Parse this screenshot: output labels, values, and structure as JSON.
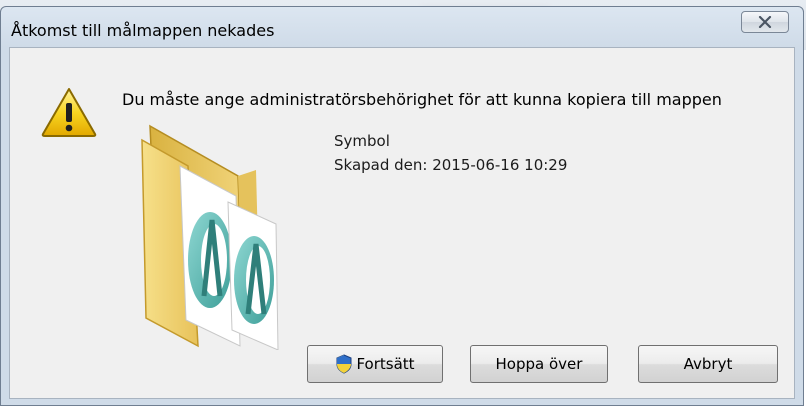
{
  "window": {
    "title": "Åtkomst till målmappen nekades",
    "close_symbol": "✕"
  },
  "dialog": {
    "message": "Du måste ange administratörsbehörighet för att kunna kopiera till mappen",
    "item_name": "Symbol",
    "item_created": "Skapad den: 2015-06-16 10:29",
    "icons": [
      "warning-icon",
      "folder-icon",
      "shield-icon",
      "close-icon"
    ]
  },
  "buttons": {
    "continue": "Fortsätt",
    "skip": "Hoppa över",
    "cancel": "Avbryt"
  },
  "colors": {
    "title_bg": "#cfdbe8",
    "client_bg": "#f0f0f0",
    "warning_yellow": "#f5c400",
    "shield_blue": "#2f6fc9"
  }
}
